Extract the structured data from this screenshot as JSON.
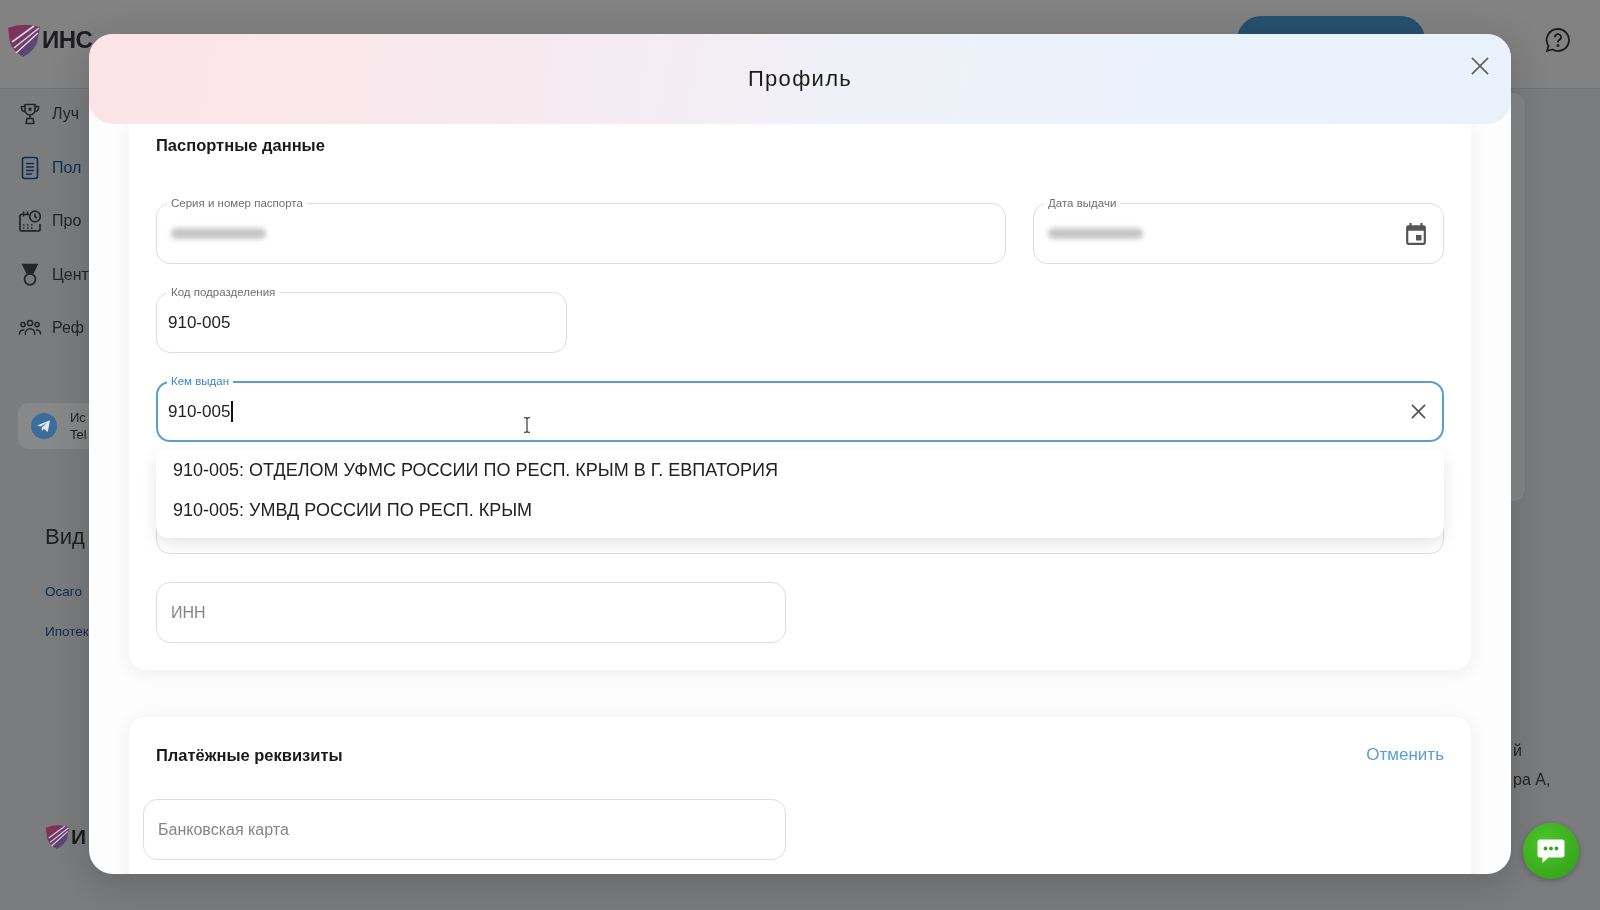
{
  "page": {
    "logo": {
      "text": "ИНС"
    },
    "sidebar": {
      "items": [
        {
          "label": "Луч",
          "selected": false
        },
        {
          "label": "Пол",
          "selected": true
        },
        {
          "label": "Про",
          "selected": false
        },
        {
          "label": "Цент",
          "selected": false
        },
        {
          "label": "Реф",
          "selected": false
        }
      ],
      "promo_card": {
        "lines": [
          "Ис",
          "Tel"
        ]
      }
    },
    "footer": {
      "heading": "Вид",
      "links": [
        "Осаго",
        "Ипотек"
      ],
      "logo_text": "И"
    },
    "right_column": {
      "lines": [
        "й",
        "ра А,"
      ]
    }
  },
  "modal": {
    "title": "Профиль",
    "passport": {
      "title": "Паспортные данные",
      "series_number": {
        "label": "Серия и номер паспорта",
        "blurred": true
      },
      "issue_date": {
        "label": "Дата выдачи",
        "blurred": true
      },
      "division_code": {
        "label": "Код подразделения",
        "value": "910-005"
      },
      "issued_by": {
        "label": "Кем выдан",
        "value": "910-005",
        "focused": true,
        "hovered": true,
        "suggestions": [
          {
            "text": "910-005: ОТДЕЛОМ УФМС РОССИИ ПО РЕСП. КРЫМ В Г. ЕВПАТОРИЯ",
            "selected": false
          },
          {
            "text": "910-005: УМВД РОССИИ ПО РЕСП. КРЫМ",
            "selected": false
          }
        ]
      },
      "inn": {
        "placeholder": "ИНН"
      }
    },
    "payment": {
      "title": "Платёжные реквизиты",
      "cancel_link": "Отменить",
      "card_field": {
        "placeholder": "Банковская карта"
      }
    }
  }
}
